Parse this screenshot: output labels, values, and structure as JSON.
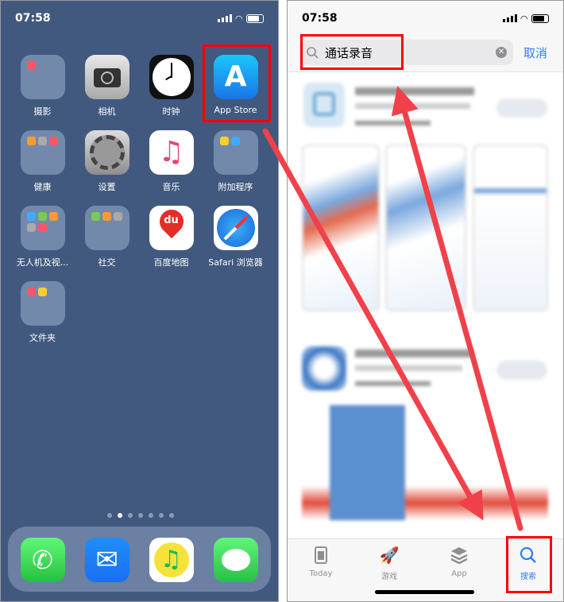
{
  "left_screen": {
    "status": {
      "time": "07:58"
    },
    "apps": [
      {
        "label": "摄影",
        "type": "folder"
      },
      {
        "label": "相机",
        "type": "camera"
      },
      {
        "label": "时钟",
        "type": "clock"
      },
      {
        "label": "App Store",
        "type": "appstore"
      },
      {
        "label": "健康",
        "type": "folder"
      },
      {
        "label": "设置",
        "type": "settings"
      },
      {
        "label": "音乐",
        "type": "music"
      },
      {
        "label": "附加程序",
        "type": "folder"
      },
      {
        "label": "无人机及视...",
        "type": "folder"
      },
      {
        "label": "社交",
        "type": "folder"
      },
      {
        "label": "百度地图",
        "type": "baidu-maps",
        "icon_text": "du"
      },
      {
        "label": "Safari 浏览器",
        "type": "safari"
      },
      {
        "label": "文件夹",
        "type": "folder"
      }
    ],
    "page_dots": {
      "count": 7,
      "active": 1
    },
    "dock": [
      "phone",
      "mail",
      "qq-music",
      "messages"
    ]
  },
  "right_screen": {
    "status": {
      "time": "07:58"
    },
    "search": {
      "value": "通话录音",
      "cancel_label": "取消"
    },
    "tabs": [
      {
        "label": "Today",
        "icon": "today-icon",
        "active": false
      },
      {
        "label": "游戏",
        "icon": "rocket-icon",
        "active": false
      },
      {
        "label": "App",
        "icon": "layers-icon",
        "active": false
      },
      {
        "label": "搜索",
        "icon": "search-icon",
        "active": true
      }
    ]
  },
  "colors": {
    "accent": "#2f7cf6",
    "annotation": "#ff0000",
    "arrow": "#f0414a",
    "wallpaper": "#41597f"
  }
}
